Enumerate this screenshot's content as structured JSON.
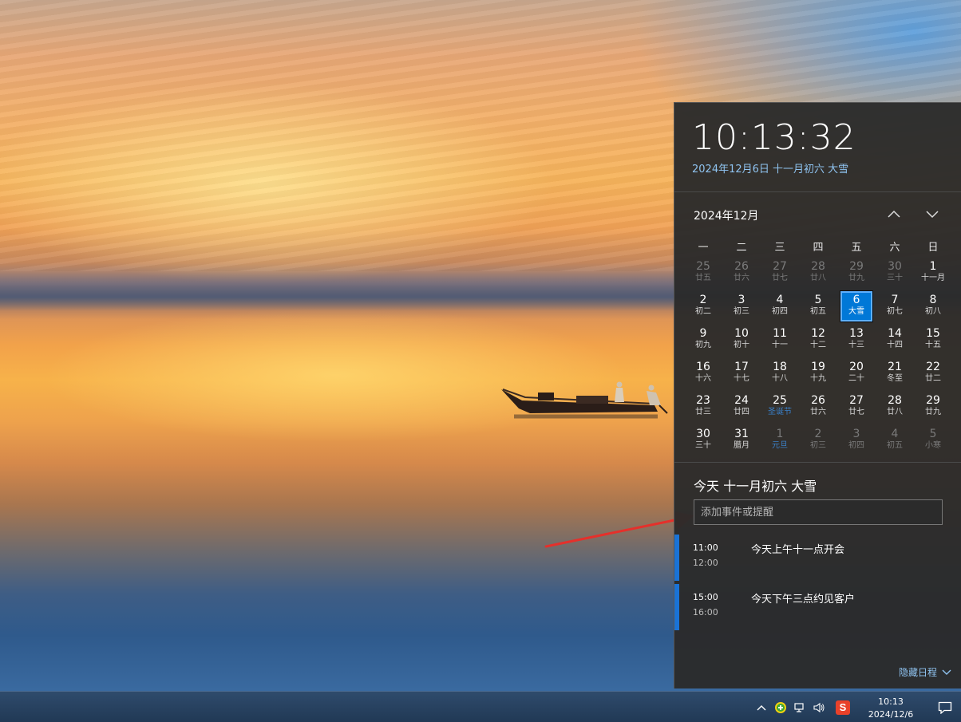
{
  "flyout": {
    "time": "10:13:32",
    "full_date": "2024年12月6日 十一月初六 大雪",
    "month_title": "2024年12月",
    "weekdays": [
      "一",
      "二",
      "三",
      "四",
      "五",
      "六",
      "日"
    ],
    "weeks": [
      [
        {
          "n": "25",
          "l": "廿五",
          "o": true
        },
        {
          "n": "26",
          "l": "廿六",
          "o": true
        },
        {
          "n": "27",
          "l": "廿七",
          "o": true
        },
        {
          "n": "28",
          "l": "廿八",
          "o": true
        },
        {
          "n": "29",
          "l": "廿九",
          "o": true
        },
        {
          "n": "30",
          "l": "三十",
          "o": true
        },
        {
          "n": "1",
          "l": "十一月"
        }
      ],
      [
        {
          "n": "2",
          "l": "初二"
        },
        {
          "n": "3",
          "l": "初三"
        },
        {
          "n": "4",
          "l": "初四"
        },
        {
          "n": "5",
          "l": "初五"
        },
        {
          "n": "6",
          "l": "大雪",
          "today": true
        },
        {
          "n": "7",
          "l": "初七"
        },
        {
          "n": "8",
          "l": "初八"
        }
      ],
      [
        {
          "n": "9",
          "l": "初九"
        },
        {
          "n": "10",
          "l": "初十"
        },
        {
          "n": "11",
          "l": "十一"
        },
        {
          "n": "12",
          "l": "十二"
        },
        {
          "n": "13",
          "l": "十三"
        },
        {
          "n": "14",
          "l": "十四"
        },
        {
          "n": "15",
          "l": "十五"
        }
      ],
      [
        {
          "n": "16",
          "l": "十六"
        },
        {
          "n": "17",
          "l": "十七"
        },
        {
          "n": "18",
          "l": "十八"
        },
        {
          "n": "19",
          "l": "十九"
        },
        {
          "n": "20",
          "l": "二十"
        },
        {
          "n": "21",
          "l": "冬至"
        },
        {
          "n": "22",
          "l": "廿二"
        }
      ],
      [
        {
          "n": "23",
          "l": "廿三"
        },
        {
          "n": "24",
          "l": "廿四"
        },
        {
          "n": "25",
          "l": "圣诞节",
          "festival": true
        },
        {
          "n": "26",
          "l": "廿六"
        },
        {
          "n": "27",
          "l": "廿七"
        },
        {
          "n": "28",
          "l": "廿八"
        },
        {
          "n": "29",
          "l": "廿九"
        }
      ],
      [
        {
          "n": "30",
          "l": "三十"
        },
        {
          "n": "31",
          "l": "腊月"
        },
        {
          "n": "1",
          "l": "元旦",
          "o": true,
          "festival": true
        },
        {
          "n": "2",
          "l": "初三",
          "o": true
        },
        {
          "n": "3",
          "l": "初四",
          "o": true
        },
        {
          "n": "4",
          "l": "初五",
          "o": true
        },
        {
          "n": "5",
          "l": "小寒",
          "o": true
        }
      ]
    ],
    "agenda_title": "今天 十一月初六 大雪",
    "event_placeholder": "添加事件或提醒",
    "events": [
      {
        "start": "11:00",
        "end": "12:00",
        "title": "今天上午十一点开会"
      },
      {
        "start": "15:00",
        "end": "16:00",
        "title": "今天下午三点约见客户"
      }
    ],
    "hide_agenda_label": "隐藏日程"
  },
  "taskbar": {
    "clock_time": "10:13",
    "clock_date": "2024/12/6",
    "ime_label": "S"
  },
  "colors": {
    "accent": "#0078d7",
    "flyout_bg": "#2b2b2b",
    "link": "#8fc3f0",
    "arrow": "#e5302b"
  }
}
